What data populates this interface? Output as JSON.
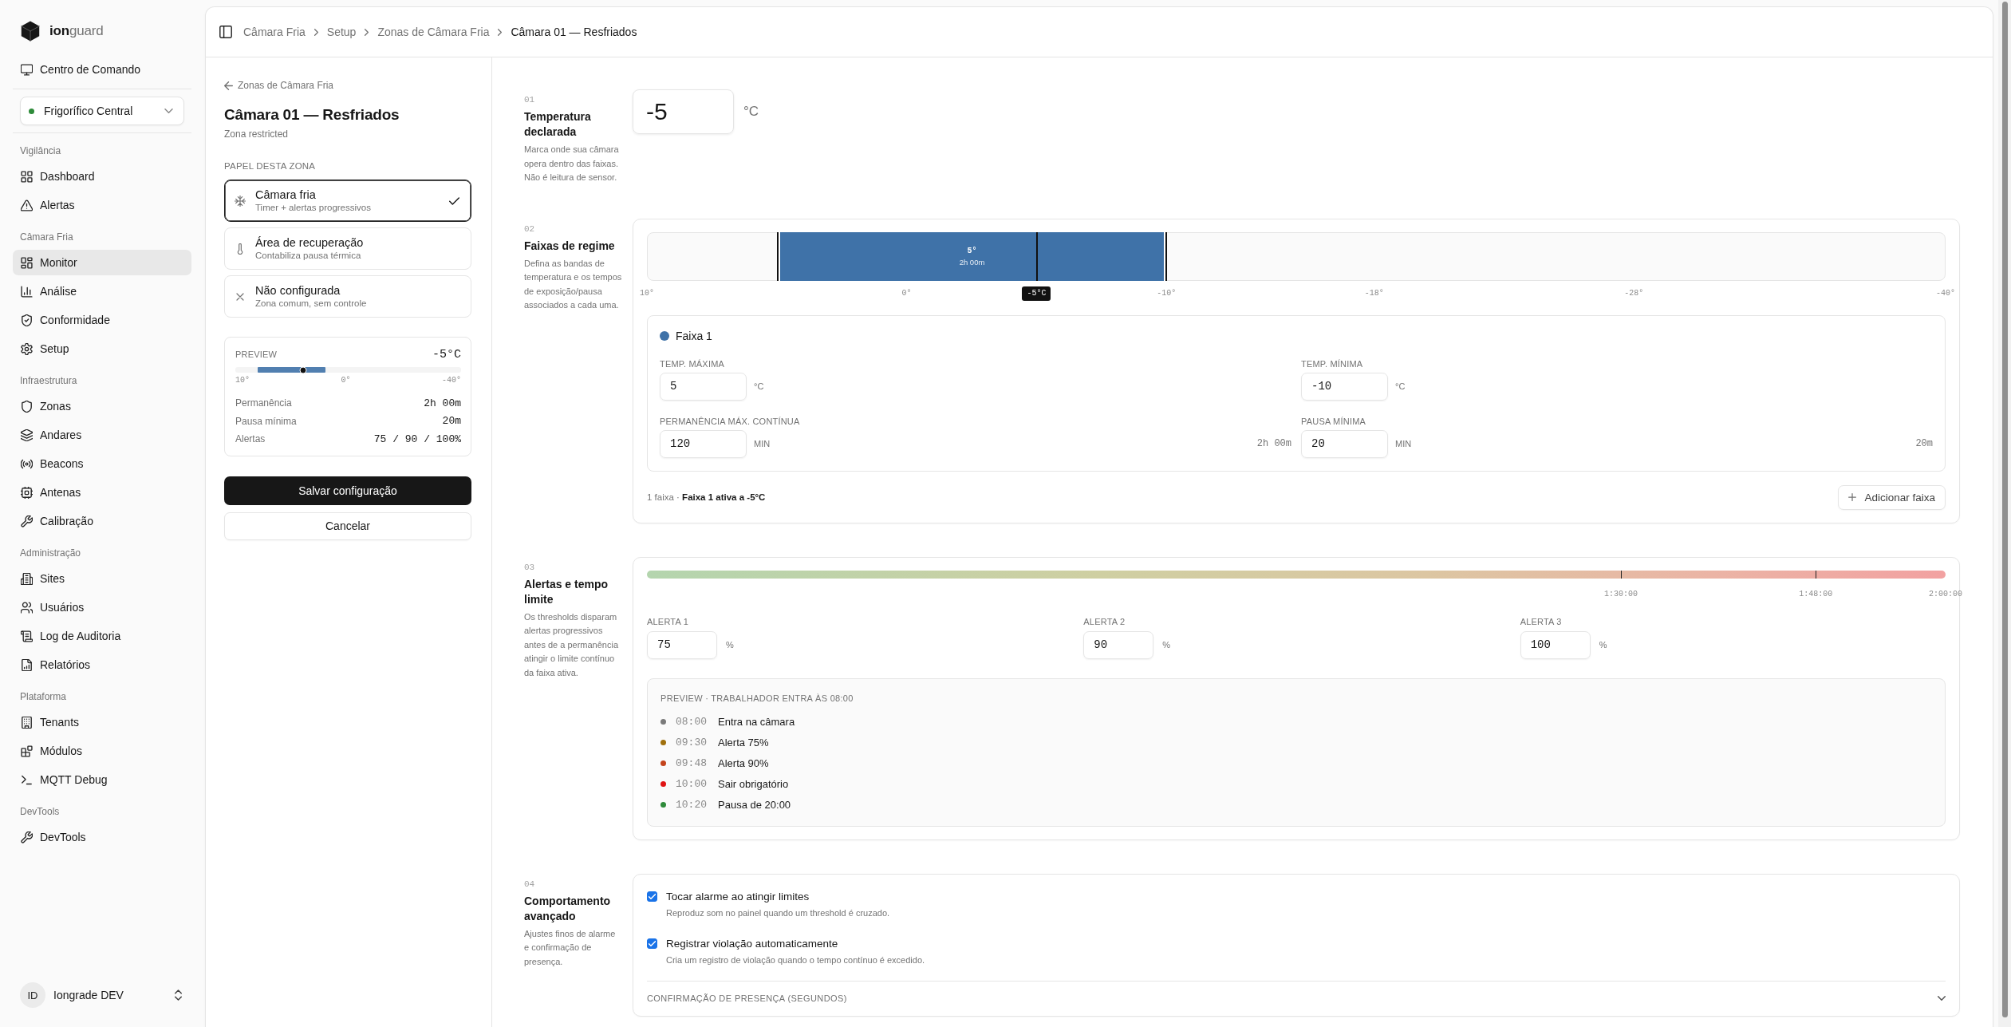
{
  "sidebar": {
    "brand": "**ion**guard",
    "command_center": "Centro de Comando",
    "site_selector": "Frigorífico Central",
    "groups": [
      {
        "label": "Vigilância",
        "items": [
          {
            "label": "Dashboard",
            "selected": false
          },
          {
            "label": "Alertas",
            "selected": false
          }
        ]
      },
      {
        "label": "Câmara Fria",
        "items": [
          {
            "label": "Monitor",
            "selected": true
          },
          {
            "label": "Análise",
            "selected": false
          },
          {
            "label": "Conformidade",
            "selected": false
          },
          {
            "label": "Setup",
            "selected": false
          }
        ]
      },
      {
        "label": "Infraestrutura",
        "items": [
          {
            "label": "Zonas",
            "selected": false
          },
          {
            "label": "Andares",
            "selected": false
          },
          {
            "label": "Beacons",
            "selected": false
          },
          {
            "label": "Antenas",
            "selected": false
          },
          {
            "label": "Calibração",
            "selected": false
          }
        ]
      },
      {
        "label": "Administração",
        "items": [
          {
            "label": "Sites",
            "selected": false
          },
          {
            "label": "Usuários",
            "selected": false
          },
          {
            "label": "Log de Auditoria",
            "selected": false
          },
          {
            "label": "Relatórios",
            "selected": false
          }
        ]
      },
      {
        "label": "Plataforma",
        "items": [
          {
            "label": "Tenants",
            "selected": false
          },
          {
            "label": "Módulos",
            "selected": false
          },
          {
            "label": "MQTT Debug",
            "selected": false
          }
        ]
      },
      {
        "label": "DevTools",
        "items": [
          {
            "label": "DevTools",
            "selected": false
          }
        ]
      }
    ],
    "user": {
      "initials": "ID",
      "name": "Iongrade DEV"
    }
  },
  "breadcrumb": [
    {
      "label": "Câmara Fria",
      "current": false
    },
    {
      "label": "Setup",
      "current": false
    },
    {
      "label": "Zonas de Câmara Fria",
      "current": false
    },
    {
      "label": "Câmara 01 — Resfriados",
      "current": true
    }
  ],
  "zone_panel": {
    "back_link": "Zonas de Câmara Fria",
    "title": "Câmara 01 — Resfriados",
    "subtitle": "Zona restricted",
    "role_heading": "PAPEL DESTA ZONA",
    "roles": [
      {
        "title": "Câmara fria",
        "description": "Timer + alertas progressivos",
        "selected": true
      },
      {
        "title": "Área de recuperação",
        "description": "Contabiliza pausa térmica",
        "selected": false
      },
      {
        "title": "Não configurada",
        "description": "Zona comum, sem controle",
        "selected": false
      }
    ],
    "preview": {
      "label": "PREVIEW",
      "reading": "-5°C",
      "axis_labels": [
        "10°",
        "0°",
        "-40°"
      ],
      "stats": [
        {
          "label": "Permanência",
          "value": "2h 00m"
        },
        {
          "label": "Pausa mínima",
          "value": "20m"
        },
        {
          "label": "Alertas",
          "value": "75 / 90 / 100%"
        }
      ]
    },
    "save_button": "Salvar configuração",
    "cancel_button": "Cancelar"
  },
  "sections": {
    "temperature": {
      "number": "01",
      "title": "Temperatura declarada",
      "description": "Marca onde sua câmara opera dentro das faixas. Não é leitura de sensor.",
      "value": "-5",
      "unit": "°C"
    },
    "regime": {
      "number": "02",
      "title": "Faixas de regime",
      "description": "Defina as bandas de temperatura e os tempos de exposição/pausa associados a cada uma.",
      "scale": [
        {
          "label": "10°",
          "level": 0
        },
        {
          "label": "0°",
          "level": 0.2
        },
        {
          "label": "-10°",
          "level": 0.4
        },
        {
          "label": "-18°",
          "level": 0.56
        },
        {
          "label": "-28°",
          "level": 0.76
        },
        {
          "label": "-40°",
          "level": 1
        }
      ],
      "bands": [
        {
          "label": "5°",
          "duration": "2h 00m",
          "color": "#3f72a8",
          "start": {
            "level": 0.1
          },
          "end": {
            "level": 0.4
          }
        }
      ],
      "marker": {
        "label": "-5°C",
        "level": 0.3
      },
      "band_cards": [
        {
          "name": "Faixa 1",
          "color": "#3f72a8",
          "fields": [
            {
              "label": "TEMP. MÁXIMA",
              "value": "5",
              "unit": "°C"
            },
            {
              "label": "TEMP. MÍNIMA",
              "value": "-10",
              "unit": "°C"
            },
            {
              "label": "PERMANÊNCIA MÁX. CONTÍNUA",
              "value": "120",
              "unit": "MIN",
              "reading": "2h 00m"
            },
            {
              "label": "PAUSA MÍNIMA",
              "value": "20",
              "unit": "MIN",
              "reading": "20m"
            }
          ]
        }
      ],
      "summary": "1 faixa · **Faixa 1 ativa a -5°C**",
      "add_button": "Adicionar faixa"
    },
    "alerts": {
      "number": "03",
      "title": "Alertas e tempo limite",
      "description": "Os thresholds disparam alertas progressivos antes de a permanência atingir o limite contínuo da faixa ativa.",
      "timeline": [
        {
          "label": "1:30:00",
          "level": 0.75
        },
        {
          "label": "1:48:00",
          "level": 0.9
        },
        {
          "label": "2:00:00",
          "level": 1
        }
      ],
      "thresholds": [
        {
          "label": "ALERTA 1",
          "value": "75",
          "unit": "%"
        },
        {
          "label": "ALERTA 2",
          "value": "90",
          "unit": "%"
        },
        {
          "label": "ALERTA 3",
          "value": "100",
          "unit": "%"
        }
      ],
      "preview": {
        "heading": "PREVIEW · TRABALHADOR ENTRA ÀS 08:00",
        "events": [
          {
            "time": "08:00",
            "label": "Entra na câmara",
            "color": "#7a7a7a"
          },
          {
            "time": "09:30",
            "label": "Alerta 75%",
            "color": "#a0700c"
          },
          {
            "time": "09:48",
            "label": "Alerta 90%",
            "color": "#c4441c"
          },
          {
            "time": "10:00",
            "label": "Sair obrigatório",
            "color": "#e01414"
          },
          {
            "time": "10:20",
            "label": "Pausa de 20:00",
            "color": "#2e8b3a"
          }
        ]
      }
    },
    "advanced": {
      "number": "04",
      "title": "Comportamento avançado",
      "description": "Ajustes finos de alarme e confirmação de presença.",
      "options": [
        {
          "label": "Tocar alarme ao atingir limites",
          "description": "Reproduz som no painel quando um threshold é cruzado.",
          "checked": true
        },
        {
          "label": "Registrar violação automaticamente",
          "description": "Cria um registro de violação quando o tempo contínuo é excedido.",
          "checked": true
        }
      ],
      "accordion": {
        "label": "CONFIRMAÇÃO DE PRESENÇA (SEGUNDOS)",
        "expanded": false
      }
    }
  }
}
